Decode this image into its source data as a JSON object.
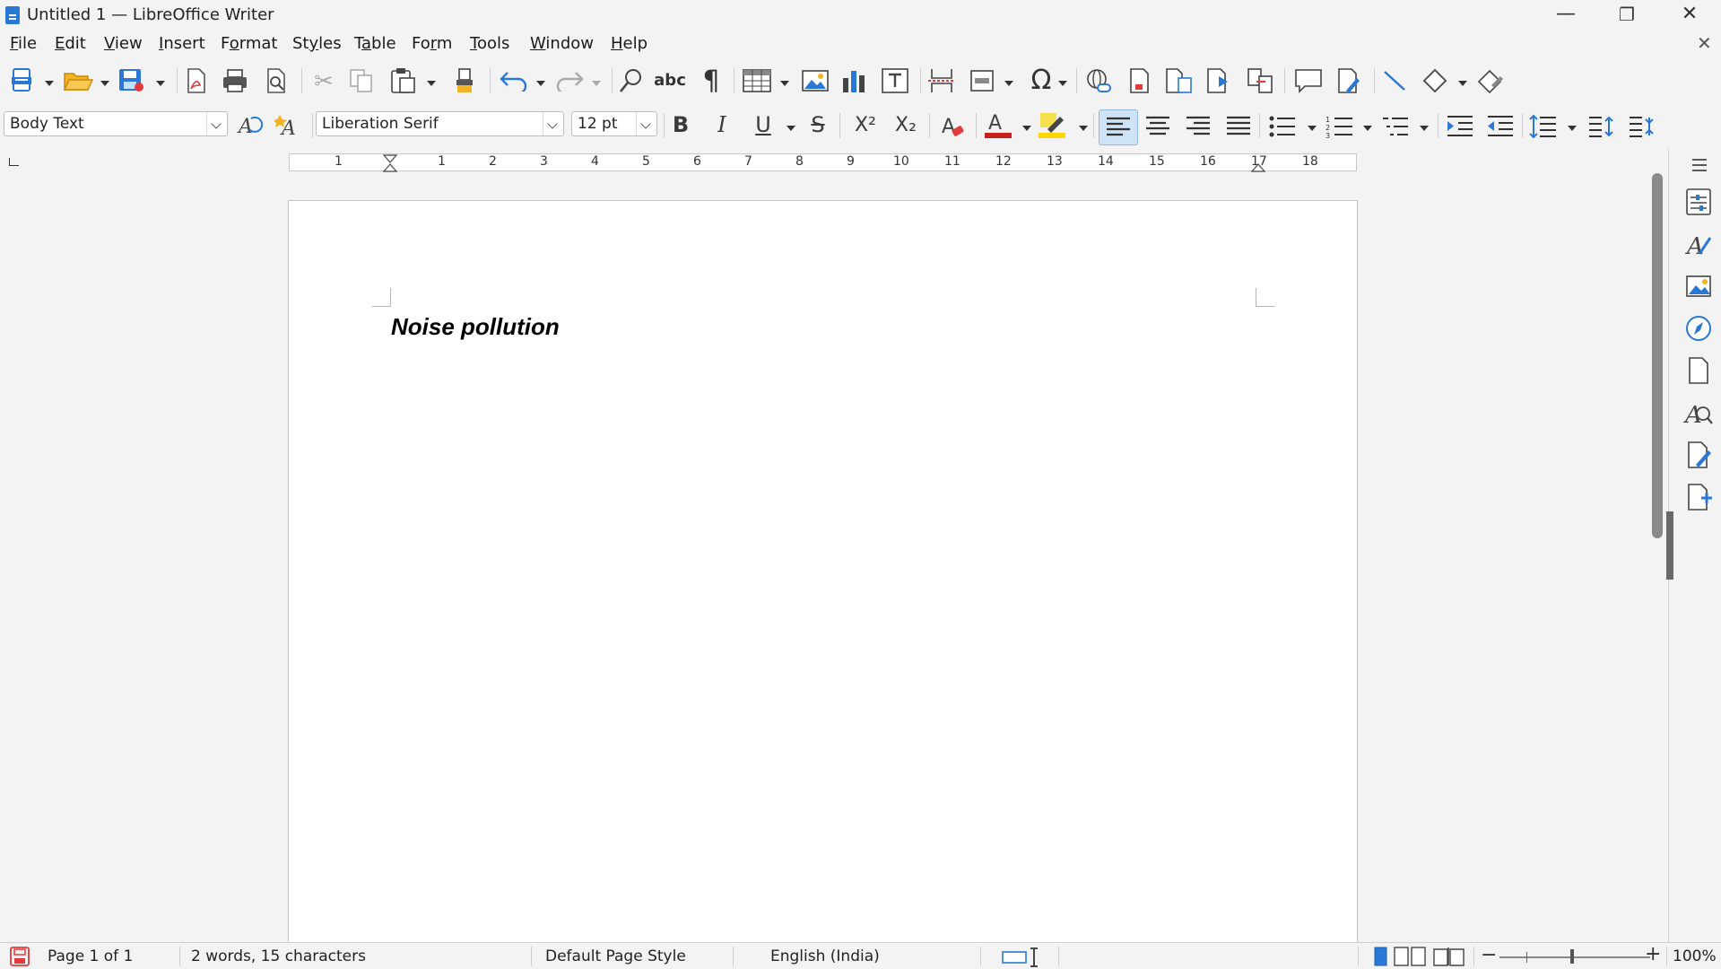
{
  "window": {
    "title": "Untitled 1 — LibreOffice Writer",
    "minimize": "—",
    "restore": "❐",
    "close": "✕"
  },
  "menus": [
    "File",
    "Edit",
    "View",
    "Insert",
    "Format",
    "Styles",
    "Table",
    "Form",
    "Tools",
    "Window",
    "Help"
  ],
  "menu_underline": [
    "F",
    "E",
    "V",
    "I",
    "o",
    "y",
    "a",
    "r",
    "T",
    "W",
    "H"
  ],
  "doc_close": "✕",
  "formatting": {
    "paragraph_style": "Body Text",
    "font_name": "Liberation Serif",
    "font_size": "12 pt"
  },
  "ruler": {
    "left_numbers": [
      "1"
    ],
    "numbers": [
      "1",
      "2",
      "3",
      "4",
      "5",
      "6",
      "7",
      "8",
      "9",
      "10",
      "11",
      "12",
      "13",
      "14",
      "15",
      "16",
      "17",
      "18"
    ]
  },
  "document": {
    "heading": "Noise pollution"
  },
  "status": {
    "page": "Page 1 of 1",
    "words": "2 words, 15 characters",
    "page_style": "Default Page Style",
    "language": "English (India)",
    "zoom": "100%"
  },
  "icons": {
    "new": "new-document-icon",
    "open": "open-icon",
    "save": "save-icon",
    "pdf": "export-pdf-icon",
    "print": "print-icon",
    "preview": "print-preview-icon",
    "cut": "cut-icon",
    "copy": "copy-icon",
    "paste": "paste-icon",
    "clone": "clone-formatting-icon",
    "undo": "undo-icon",
    "redo": "redo-icon",
    "find": "find-replace-icon",
    "spell": "spelling-icon",
    "pilcrow": "formatting-marks-icon",
    "table": "insert-table-icon",
    "image": "insert-image-icon",
    "chart": "insert-chart-icon",
    "textbox": "insert-textbox-icon"
  },
  "colors": {
    "accent": "#2a78d6",
    "font_color": "#c9211e",
    "highlight": "#ffd700",
    "active_button": "#cfe3f7"
  }
}
